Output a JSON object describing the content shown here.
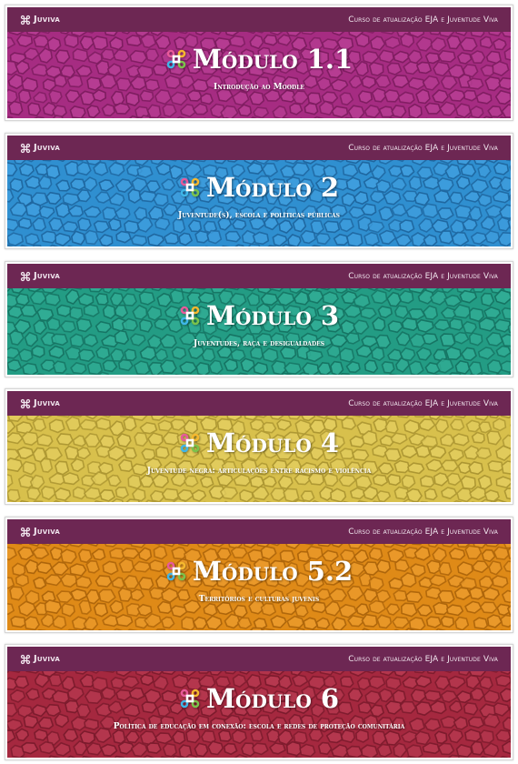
{
  "header": {
    "brand": "Juviva",
    "course": "Curso de atualização EJA e Juventude Viva"
  },
  "modules": [
    {
      "title": "Módulo 1.1",
      "subtitle": "Introdução ao Moodle",
      "color": "#a62c82",
      "cell": "#b73d93",
      "line": "#7e1d60"
    },
    {
      "title": "Módulo 2",
      "subtitle": "Juventude(s), escola e políticas públicas",
      "color": "#2f8fd0",
      "cell": "#3f9ede",
      "line": "#1f67a0"
    },
    {
      "title": "Módulo 3",
      "subtitle": "Juventudes, raça e desigualdades",
      "color": "#239c84",
      "cell": "#31ad95",
      "line": "#167463"
    },
    {
      "title": "Módulo 4",
      "subtitle": "Juventude negra: articulações entre racismo e violência",
      "color": "#d8c04c",
      "cell": "#e3cd5e",
      "line": "#ac9632"
    },
    {
      "title": "Módulo 5.2",
      "subtitle": "Territórios e culturas juvenis",
      "color": "#df8a17",
      "cell": "#eb9a2b",
      "line": "#ad650b"
    },
    {
      "title": "Módulo 6",
      "subtitle": "Política de educação em conexão: escola e redes de proteção comunitária",
      "color": "#a5283f",
      "cell": "#b6384f",
      "line": "#7c1b2d"
    }
  ],
  "icons": {
    "brand": "command-key-icon",
    "module": "command-key-colorful-icon"
  },
  "colors": {
    "header_bar": "#6d2753"
  }
}
